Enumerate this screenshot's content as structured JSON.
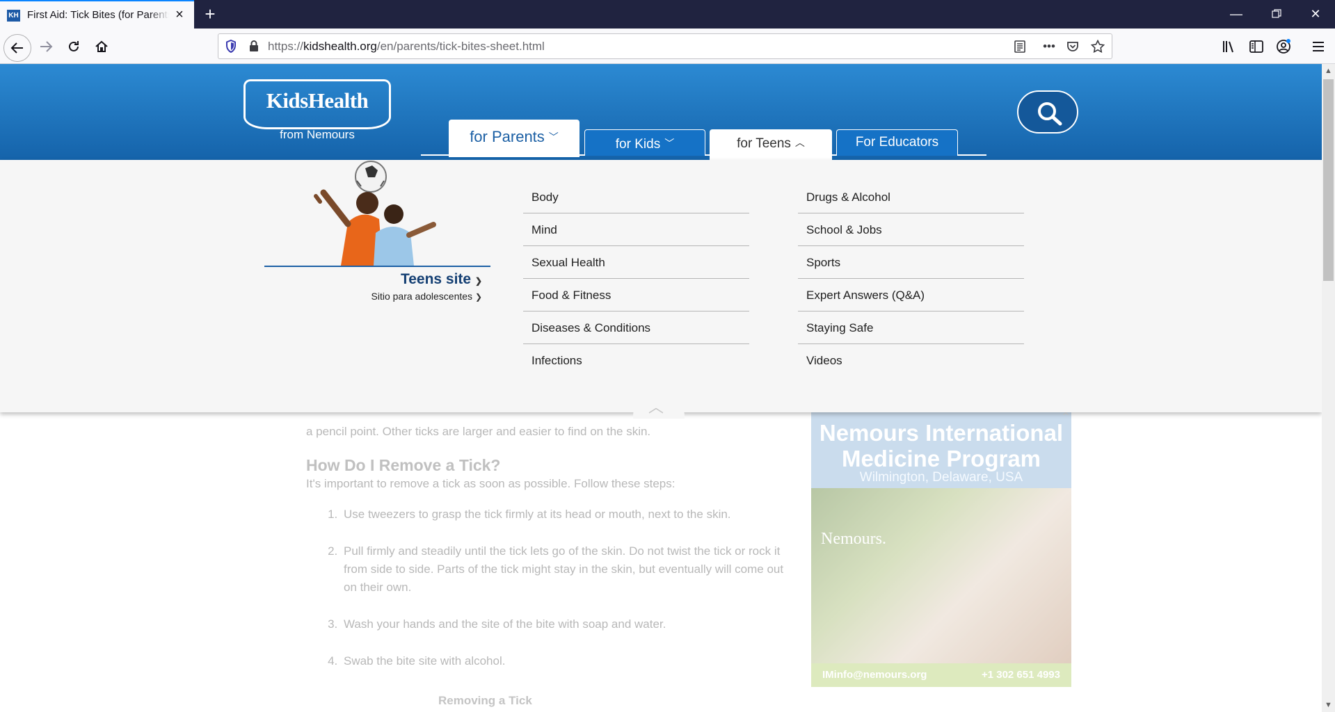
{
  "browser": {
    "tab_title": "First Aid: Tick Bites (for Parents) - Nemours KidsHealth",
    "favicon_text": "KH",
    "url_prefix": "https://",
    "url_host": "kidshealth.org",
    "url_path": "/en/parents/tick-bites-sheet.html"
  },
  "site": {
    "logo_main": "KidsHealth",
    "logo_sub": "from Nemours",
    "nav": {
      "parents": "for Parents",
      "kids": "for Kids",
      "teens": "for Teens",
      "educators": "For Educators"
    }
  },
  "dropdown": {
    "teens_site": "Teens site",
    "teens_site_es": "Sitio para adolescentes",
    "col1": [
      "Body",
      "Mind",
      "Sexual Health",
      "Food & Fitness",
      "Diseases & Conditions",
      "Infections"
    ],
    "col2": [
      "Drugs & Alcohol",
      "School & Jobs",
      "Sports",
      "Expert Answers (Q&A)",
      "Staying Safe",
      "Videos"
    ]
  },
  "article": {
    "partial_line": "a pencil point. Other ticks are larger and easier to find on the skin.",
    "heading": "How Do I Remove a Tick?",
    "intro": "It's important to remove a tick as soon as possible. Follow these steps:",
    "steps": [
      "Use tweezers to grasp the tick firmly at its head or mouth, next to the skin.",
      "Pull firmly and steadily until the tick lets go of the skin. Do not twist the tick or rock it from side to side. Parts of the tick might stay in the skin, but eventually will come out on their own.",
      "Wash your hands and the site of the bite with soap and water.",
      "Swab the bite site with alcohol."
    ],
    "subhead": "Removing a Tick"
  },
  "ad": {
    "title_line1": "Nemours International",
    "title_line2": "Medicine Program",
    "subtitle": "Wilmington, Delaware, USA",
    "photo_logo": "Nemours.",
    "email": "IMinfo@nemours.org",
    "phone": "+1 302 651 4993"
  }
}
